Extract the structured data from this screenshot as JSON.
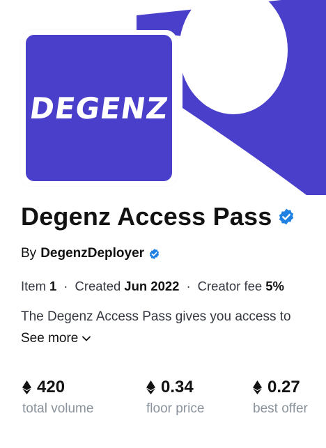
{
  "collection": {
    "logo_text": "DEGENZ",
    "title": "Degenz Access Pass",
    "by_label": "By",
    "creator_name": "DegenzDeployer"
  },
  "meta": {
    "item_label": "Item",
    "item_value": "1",
    "created_label": "Created",
    "created_value": "Jun 2022",
    "fee_label": "Creator fee",
    "fee_value": "5%"
  },
  "description": {
    "text": "The Degenz Access Pass gives you access to",
    "see_more": "See more"
  },
  "stats": [
    {
      "value": "420",
      "label": "total volume"
    },
    {
      "value": "0.34",
      "label": "floor price"
    },
    {
      "value": "0.27",
      "label": "best offer"
    }
  ],
  "colors": {
    "brand": "#4A3FCB",
    "verified": "#2081E2"
  }
}
